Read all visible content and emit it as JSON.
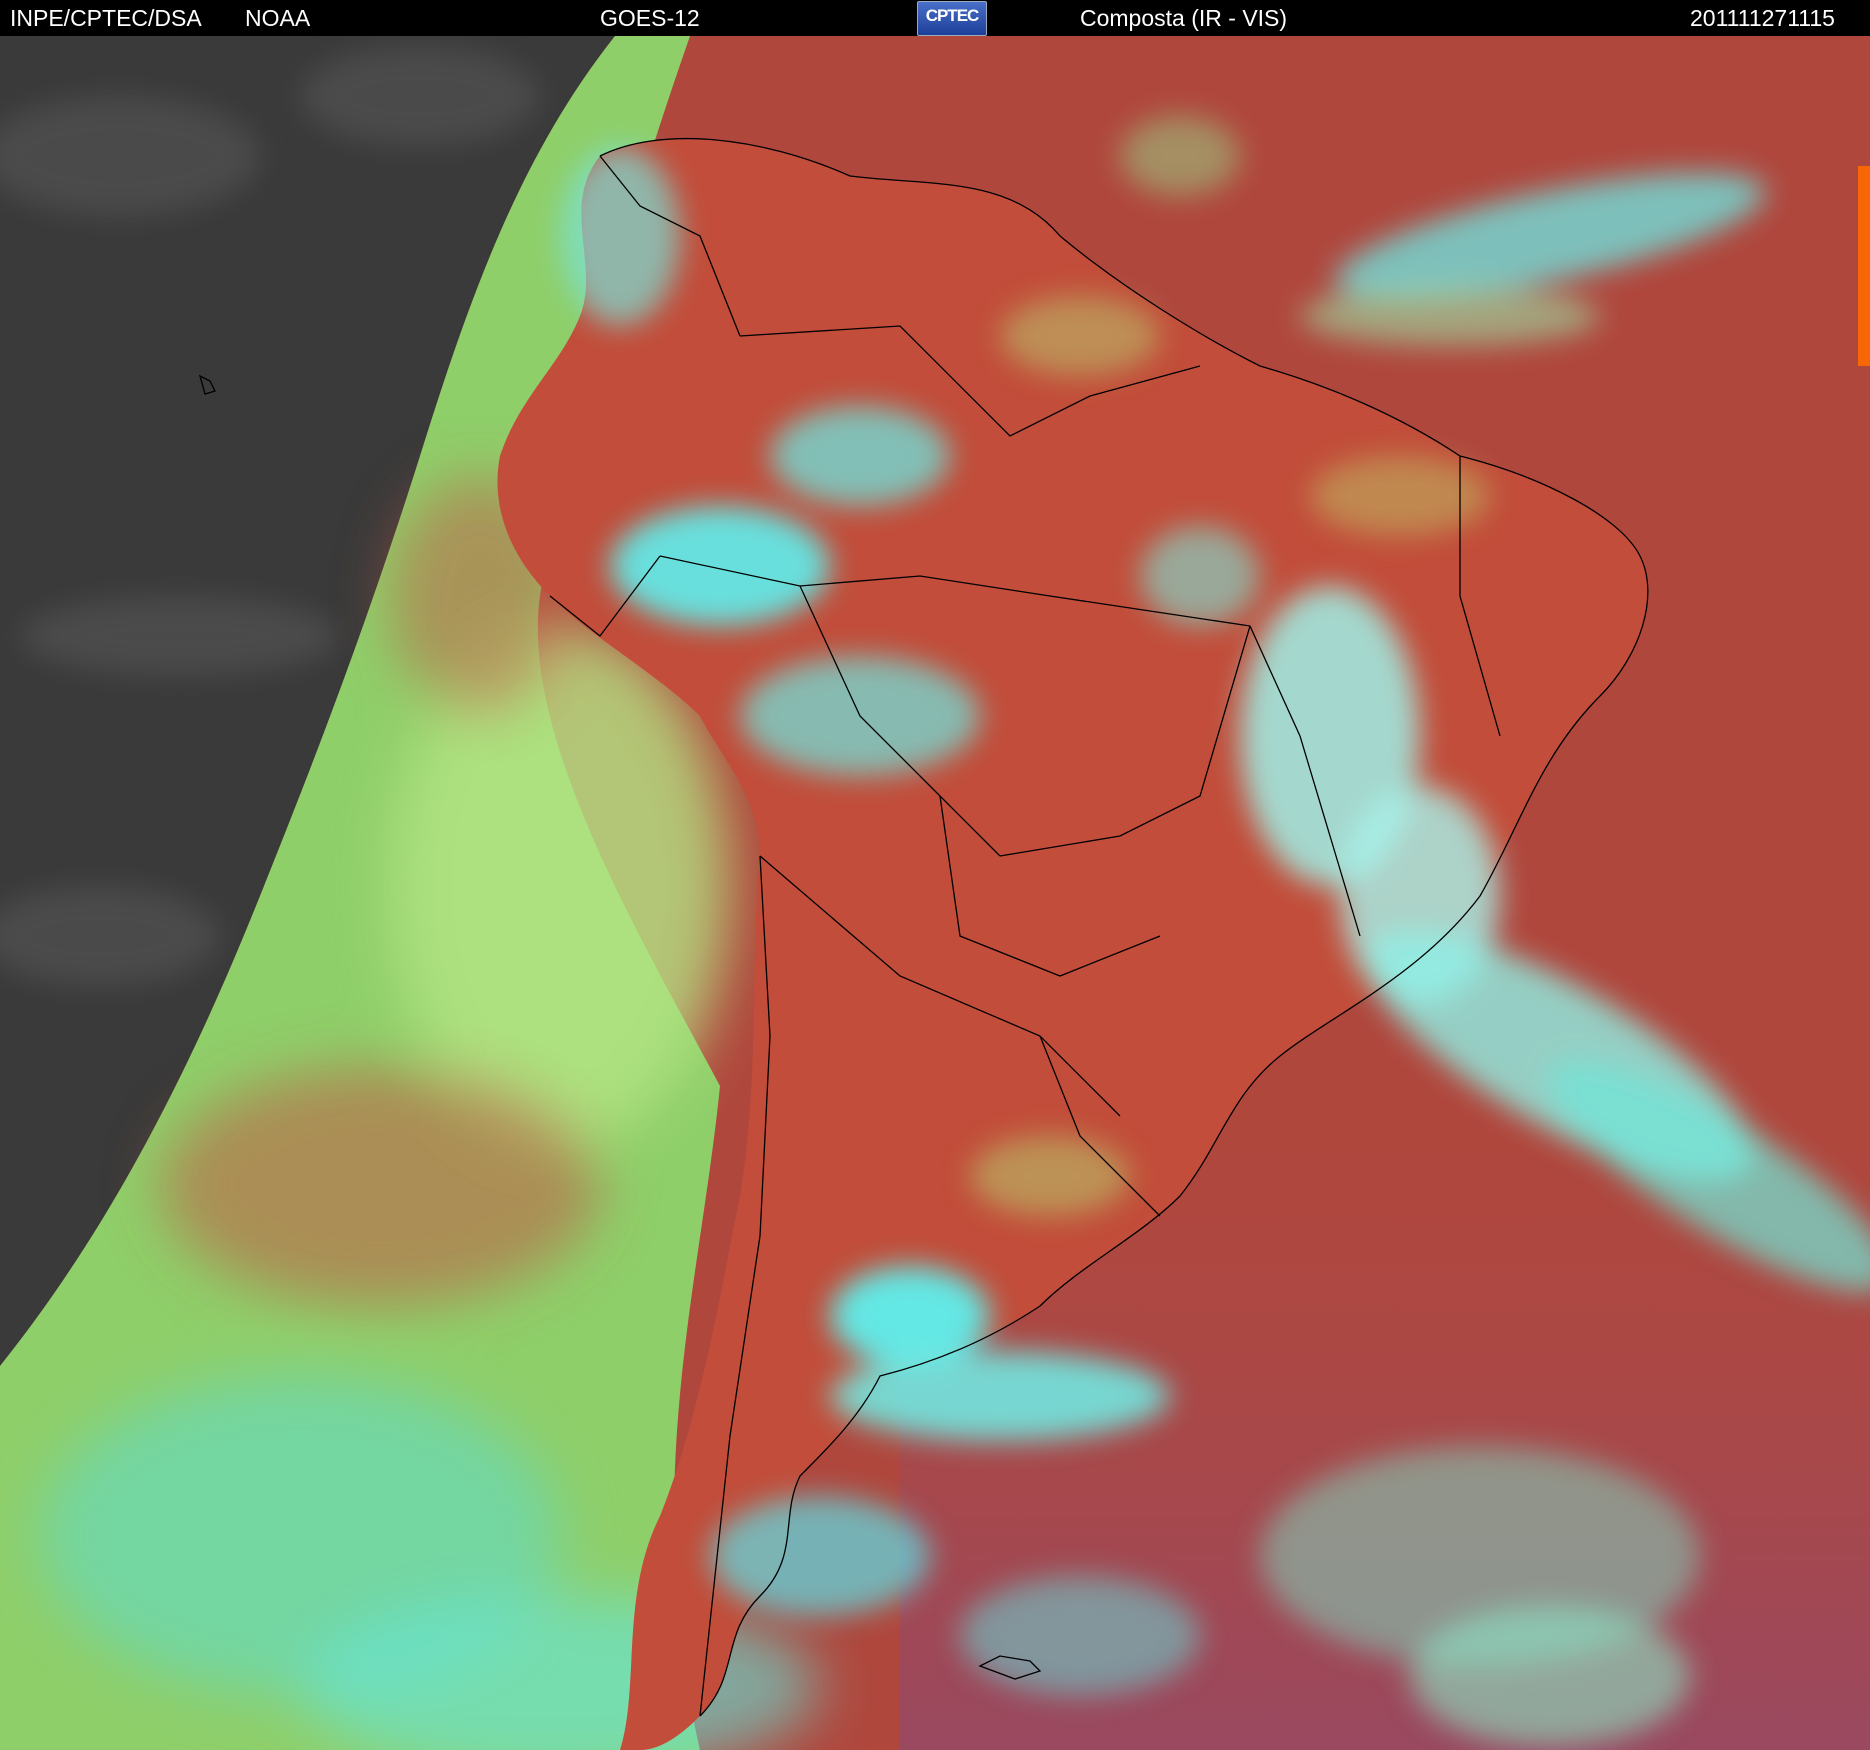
{
  "header": {
    "agency": "INPE/CPTEC/DSA",
    "source": "NOAA",
    "satellite": "GOES-12",
    "logo_text": "CPTEC",
    "product": "Composta (IR - VIS)",
    "timestamp": "201111271115"
  },
  "image": {
    "type": "satellite composite (IR - VIS) over South America",
    "colors": {
      "night_side": "#3a3a3a",
      "land_clear": "#c24d3a",
      "ocean_clear": "#a34a55",
      "low_cloud": "#9fdd6e",
      "high_cloud": "#5ef0ee",
      "border_lines": "#000000"
    }
  }
}
